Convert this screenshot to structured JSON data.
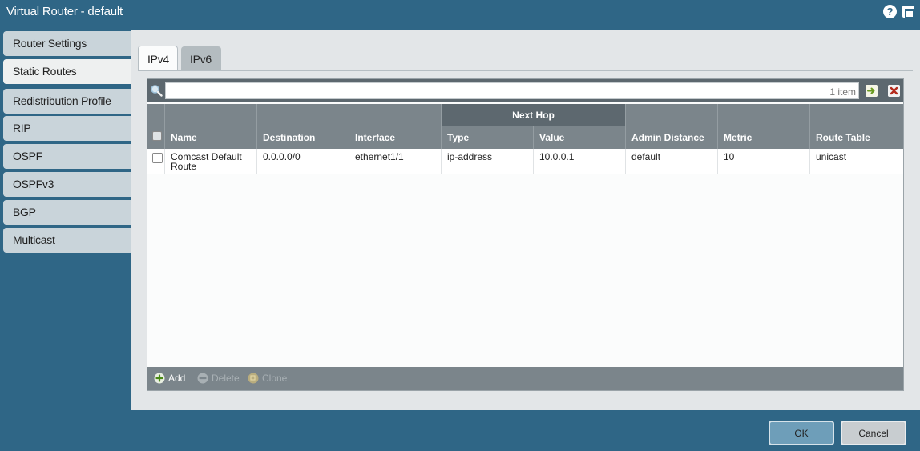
{
  "window": {
    "title": "Virtual Router - default",
    "help_icon": "help-icon",
    "maximize_icon": "maximize-icon"
  },
  "sidebar": {
    "items": [
      {
        "label": "Router Settings",
        "active": false
      },
      {
        "label": "Static Routes",
        "active": true
      },
      {
        "label": "Redistribution Profile",
        "active": false
      },
      {
        "label": "RIP",
        "active": false
      },
      {
        "label": "OSPF",
        "active": false
      },
      {
        "label": "OSPFv3",
        "active": false
      },
      {
        "label": "BGP",
        "active": false
      },
      {
        "label": "Multicast",
        "active": false
      }
    ]
  },
  "tabs": [
    {
      "label": "IPv4",
      "active": true
    },
    {
      "label": "IPv6",
      "active": false
    }
  ],
  "filter": {
    "value": "",
    "count": "1 item"
  },
  "table": {
    "group_header": "Next Hop",
    "columns": {
      "name": "Name",
      "destination": "Destination",
      "interface": "Interface",
      "type": "Type",
      "value": "Value",
      "admin_distance": "Admin Distance",
      "metric": "Metric",
      "route_table": "Route Table"
    },
    "rows": [
      {
        "name_line1": "Comcast Default",
        "name_line2": "Route",
        "destination": "0.0.0.0/0",
        "interface": "ethernet1/1",
        "type": "ip-address",
        "value": "10.0.0.1",
        "admin_distance": "default",
        "metric": "10",
        "route_table": "unicast"
      }
    ]
  },
  "actions": {
    "add": "Add",
    "delete": "Delete",
    "clone": "Clone"
  },
  "buttons": {
    "ok": "OK",
    "cancel": "Cancel"
  },
  "colors": {
    "frame": "#2f6686",
    "header": "#7b858b",
    "filterbar": "#5d686f"
  }
}
